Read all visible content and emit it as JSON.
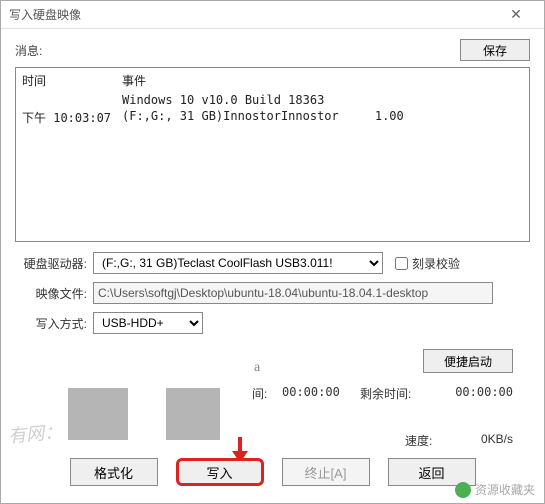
{
  "window": {
    "title": "写入硬盘映像"
  },
  "msg": {
    "label": "消息:",
    "save": "保存"
  },
  "log": {
    "headers": {
      "time": "时间",
      "event": "事件"
    },
    "rows": [
      {
        "time": "",
        "event": "Windows 10 v10.0 Build 18363"
      },
      {
        "time": "下午 10:03:07",
        "event": "(F:,G:, 31 GB)InnostorInnostor     1.00"
      }
    ]
  },
  "form": {
    "drive_label": "硬盘驱动器:",
    "drive_value": "(F:,G:, 31 GB)Teclast CoolFlash USB3.011!",
    "verify_label": "刻录校验",
    "image_label": "映像文件:",
    "image_value": "C:\\Users\\softgj\\Desktop\\ubuntu-18.04\\ubuntu-18.04.1-desktop",
    "method_label": "写入方式:",
    "method_value": "USB-HDD+"
  },
  "quick": "便捷启动",
  "times": {
    "elapsed_label": "间:",
    "elapsed_value": "00:00:00",
    "remain_label": "剩余时间:",
    "remain_value": "00:00:00",
    "speed_label": "速度:",
    "speed_value": "0KB/s"
  },
  "buttons": {
    "format": "格式化",
    "write": "写入",
    "abort": "终止[A]",
    "back": "返回"
  },
  "watermark": {
    "left": "有网：",
    "right": "资源收藏夹"
  },
  "qmark": "a"
}
